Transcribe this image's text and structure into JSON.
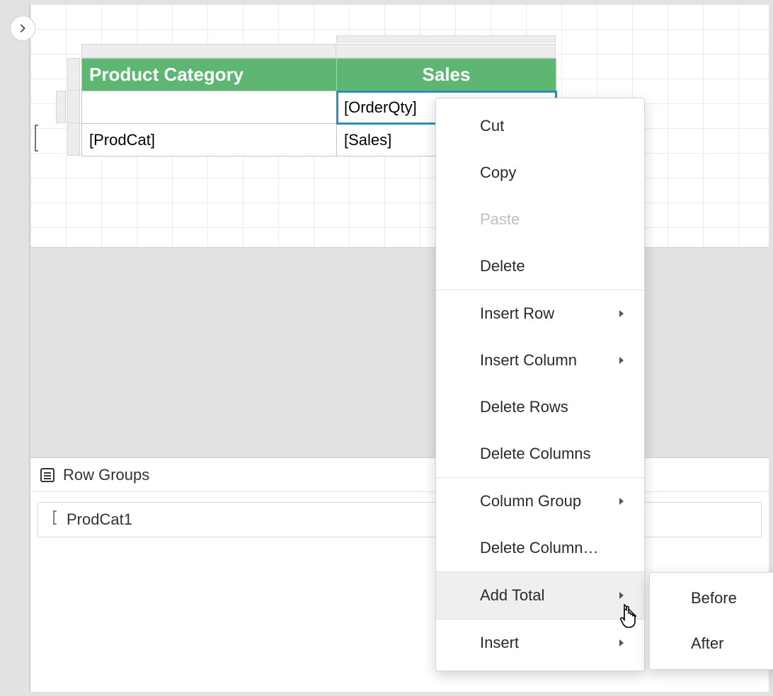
{
  "designer": {
    "headers": {
      "category": "Product Category",
      "sales": "Sales"
    },
    "cells": {
      "orderQty": "[OrderQty]",
      "prodCat": "[ProdCat]",
      "sales": "[Sales]"
    }
  },
  "rowGroupsPanel": {
    "title": "Row Groups",
    "items": [
      "ProdCat1"
    ]
  },
  "contextMenu": {
    "cut": "Cut",
    "copy": "Copy",
    "paste": "Paste",
    "delete": "Delete",
    "insertRow": "Insert Row",
    "insertColumn": "Insert Column",
    "deleteRows": "Delete Rows",
    "deleteColumns": "Delete Columns",
    "columnGroup": "Column Group",
    "deleteColumnEllipsis": "Delete Column…",
    "addTotal": "Add Total",
    "insert": "Insert"
  },
  "submenu": {
    "before": "Before",
    "after": "After"
  }
}
